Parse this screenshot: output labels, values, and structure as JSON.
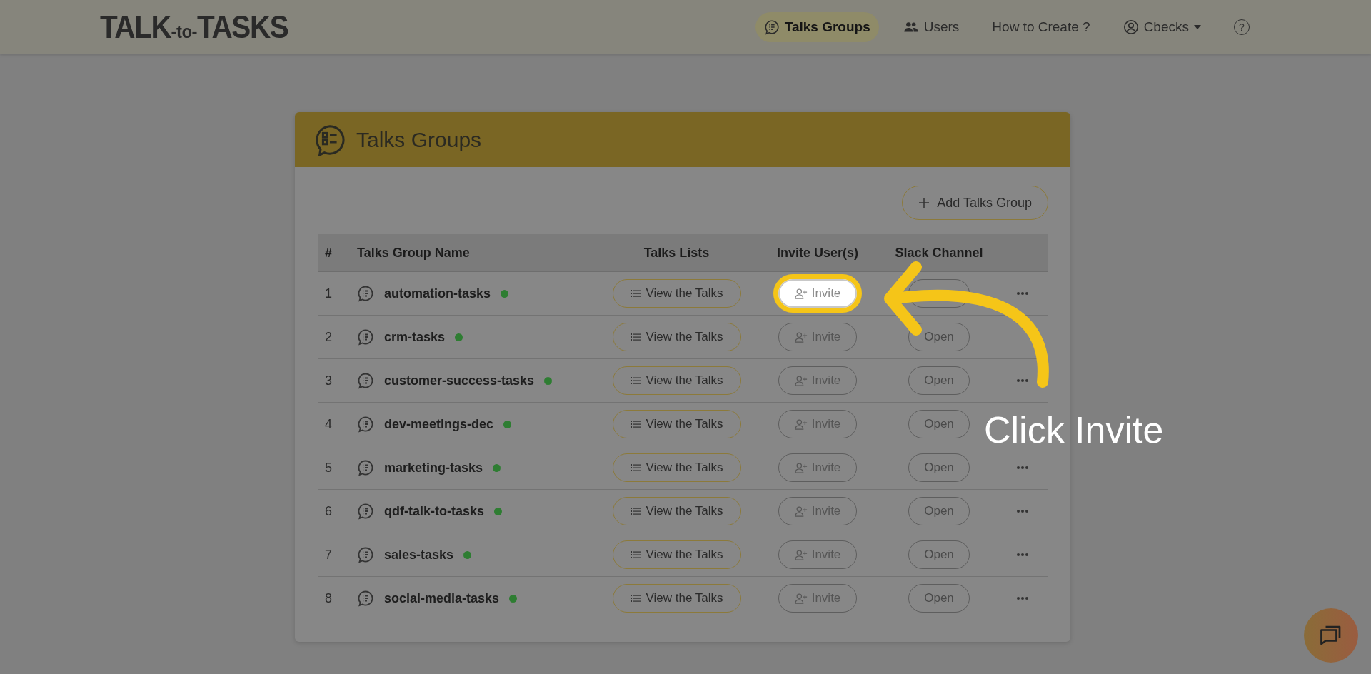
{
  "header": {
    "logo": {
      "left": "TALK",
      "joiner": "-to-",
      "right": "TASKS"
    },
    "nav": [
      {
        "label": "Talks Groups",
        "kind": "chat",
        "selected": true
      },
      {
        "label": "Users",
        "kind": "users",
        "selected": false
      },
      {
        "label": "How to Create ?",
        "kind": "plain",
        "selected": false
      },
      {
        "label": "Cbecks",
        "kind": "account",
        "selected": false
      },
      {
        "label": "?",
        "kind": "help",
        "selected": false
      }
    ]
  },
  "card": {
    "title": "Talks Groups",
    "add_button": "Add Talks Group",
    "columns": [
      "#",
      "Talks Group Name",
      "Talks Lists",
      "Invite User(s)",
      "Slack Channel"
    ],
    "rows": [
      {
        "index": "1",
        "name": "automation-tasks",
        "color": "#2e7d32",
        "talks": "View the Talks",
        "invite": "Invite",
        "highlighted": true,
        "more_menu": true
      },
      {
        "index": "2",
        "name": "crm-tasks",
        "color": "#2e7d32",
        "talks": "View the Talks",
        "invite": "Invite",
        "slack": "Open",
        "highlighted": false,
        "more_menu": false
      },
      {
        "index": "3",
        "name": "customer-success-tasks",
        "color": "#2e7d32",
        "talks": "View the Talks",
        "invite": "Invite",
        "slack": "Open",
        "highlighted": false,
        "more_menu": true
      },
      {
        "index": "4",
        "name": "dev-meetings-dec",
        "color": "#2e7d32",
        "talks": "View the Talks",
        "invite": "Invite",
        "slack": "Open",
        "highlighted": false,
        "more_menu": false
      },
      {
        "index": "5",
        "name": "marketing-tasks",
        "color": "#2e7d32",
        "talks": "View the Talks",
        "invite": "Invite",
        "slack": "Open",
        "highlighted": false,
        "more_menu": true
      },
      {
        "index": "6",
        "name": "qdf-talk-to-tasks",
        "color": "#2e7d32",
        "talks": "View the Talks",
        "invite": "Invite",
        "slack": "Open",
        "highlighted": false,
        "more_menu": true
      },
      {
        "index": "7",
        "name": "sales-tasks",
        "color": "#2e7d32",
        "talks": "View the Talks",
        "invite": "Invite",
        "slack": "Open",
        "highlighted": false,
        "more_menu": true
      },
      {
        "index": "8",
        "name": "social-media-tasks",
        "color": "#2e7d32",
        "talks": "View the Talks",
        "invite": "Invite",
        "slack": "Open",
        "highlighted": false,
        "more_menu": true
      }
    ]
  },
  "annotation": {
    "caption": "Click Invite"
  }
}
